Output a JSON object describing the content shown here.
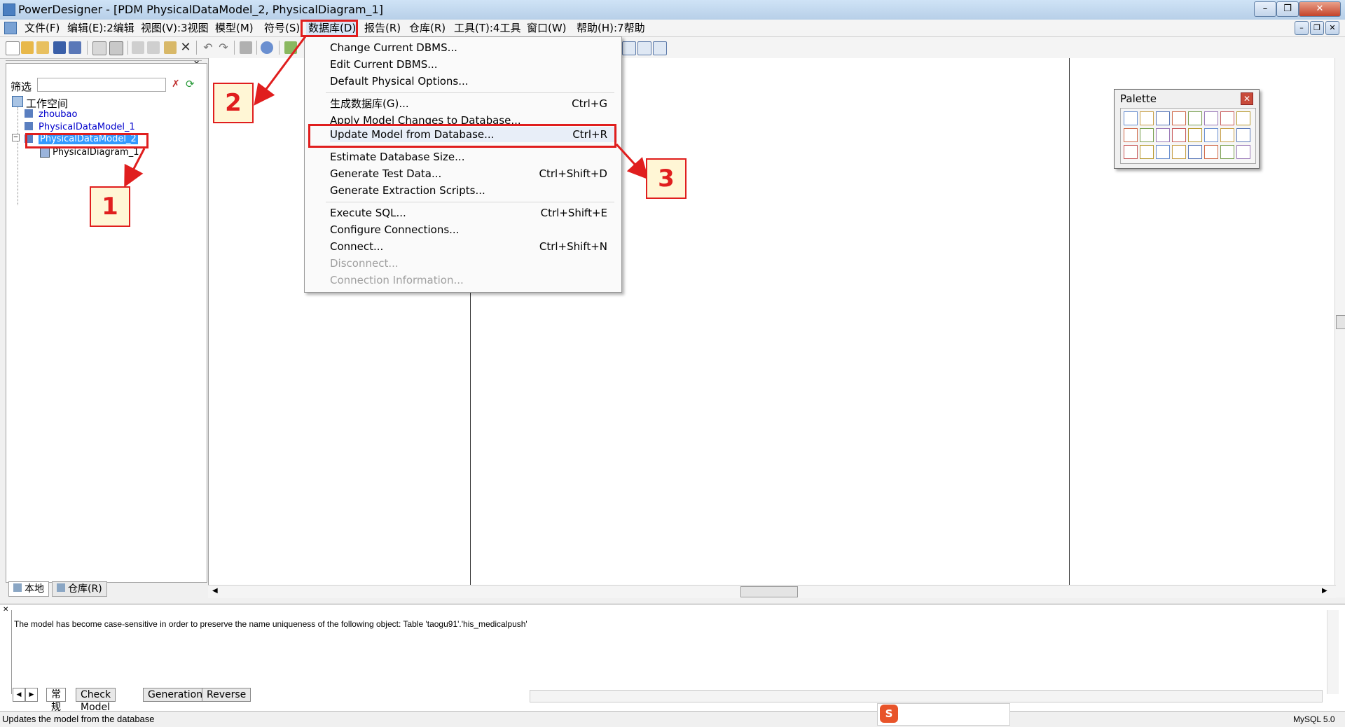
{
  "window": {
    "title": "PowerDesigner - [PDM PhysicalDataModel_2, PhysicalDiagram_1]",
    "controls": [
      "–",
      "❐",
      "✕"
    ],
    "doc_controls": [
      "–",
      "❐",
      "✕"
    ]
  },
  "menubar": {
    "items": [
      "文件(F)",
      "编辑(E):2编辑",
      "视图(V):3视图",
      "模型(M)",
      "符号(S)",
      "数据库(D)",
      "报告(R)",
      "仓库(R)",
      "工具(T):4工具",
      "窗口(W)",
      "帮助(H):7帮助"
    ]
  },
  "browser": {
    "filter_label": "筛选",
    "tree": {
      "workspace": "工作空间",
      "items": [
        "zhoubao",
        "PhysicalDataModel_1",
        "PhysicalDataModel_2"
      ],
      "child": "PhysicalDiagram_1"
    },
    "tabs": [
      "本地",
      "仓库(R)"
    ]
  },
  "database_menu": {
    "items": [
      {
        "label": "Change Current DBMS...",
        "shortcut": ""
      },
      {
        "label": "Edit Current DBMS...",
        "shortcut": ""
      },
      {
        "label": "Default Physical Options...",
        "shortcut": ""
      },
      {
        "label": "生成数据库(G)...",
        "shortcut": "Ctrl+G"
      },
      {
        "label": "Apply Model Changes to Database...",
        "shortcut": ""
      },
      {
        "label": "Update Model from Database...",
        "shortcut": "Ctrl+R"
      },
      {
        "label": "Estimate Database Size...",
        "shortcut": ""
      },
      {
        "label": "Generate Test Data...",
        "shortcut": "Ctrl+Shift+D"
      },
      {
        "label": "Generate Extraction Scripts...",
        "shortcut": ""
      },
      {
        "label": "Execute SQL...",
        "shortcut": "Ctrl+Shift+E"
      },
      {
        "label": "Configure Connections...",
        "shortcut": ""
      },
      {
        "label": "Connect...",
        "shortcut": "Ctrl+Shift+N"
      },
      {
        "label": "Disconnect...",
        "shortcut": ""
      },
      {
        "label": "Connection Information...",
        "shortcut": ""
      }
    ]
  },
  "palette": {
    "title": "Palette"
  },
  "output": {
    "message": "The model has become case-sensitive in order to preserve the name uniqueness of the following object: Table 'taogu91'.'his_medicalpush'",
    "tabs": [
      "常规",
      "Check Model",
      "Generation",
      "Reverse"
    ]
  },
  "status": {
    "text": "Updates the model from the database",
    "dbms": "MySQL 5.0"
  },
  "annotations": {
    "labels": [
      "1",
      "2",
      "3"
    ]
  },
  "colors": {
    "highlight_red": "#e01e1e",
    "selection_blue": "#3399ff",
    "link_blue": "#0000cc"
  }
}
